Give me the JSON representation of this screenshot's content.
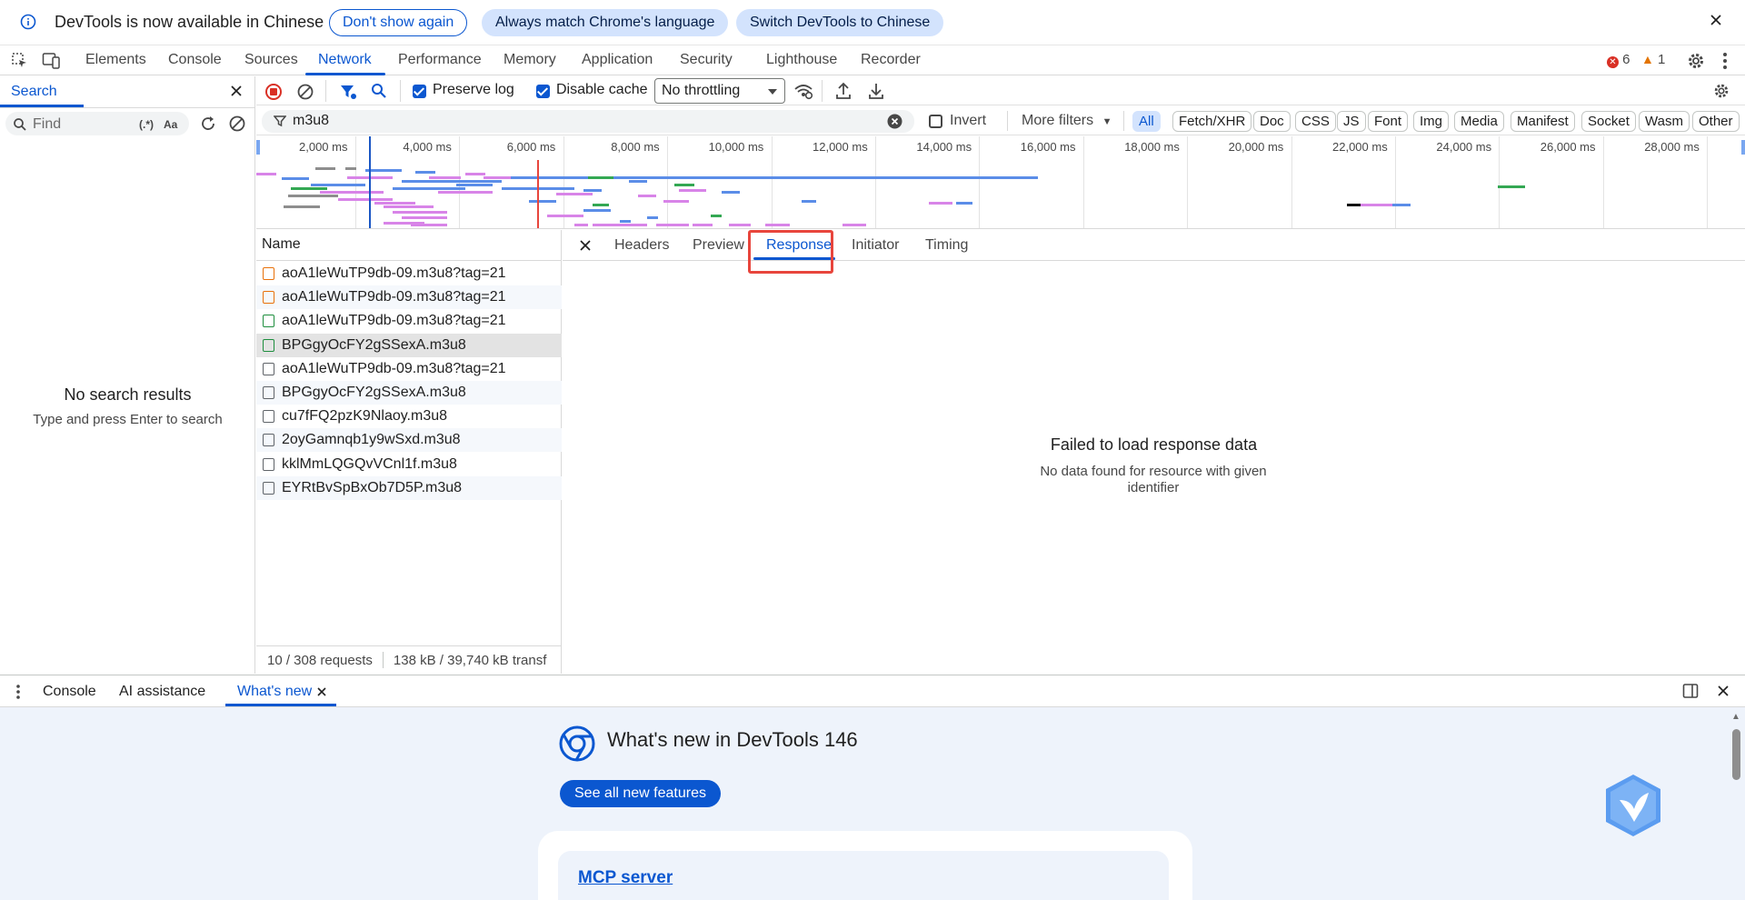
{
  "infobar": {
    "message": "DevTools is now available in Chinese",
    "dont_show": "Don't show again",
    "always_match": "Always match Chrome's language",
    "switch": "Switch DevTools to Chinese"
  },
  "main_tabs": [
    "Elements",
    "Console",
    "Sources",
    "Network",
    "Performance",
    "Memory",
    "Application",
    "Security",
    "Lighthouse",
    "Recorder"
  ],
  "badges": {
    "errors": "6",
    "warnings": "1"
  },
  "search_panel": {
    "tab": "Search",
    "find_placeholder": "Find",
    "regex": "(.*)",
    "case": "Aa",
    "no_results": "No search results",
    "hint": "Type and press Enter to search"
  },
  "toolbar": {
    "preserve_log": "Preserve log",
    "disable_cache": "Disable cache",
    "throttling": "No throttling"
  },
  "filter": {
    "value": "m3u8",
    "invert": "Invert",
    "more_filters": "More filters",
    "chips": [
      "All",
      "Fetch/XHR",
      "Doc",
      "CSS",
      "JS",
      "Font",
      "Img",
      "Media",
      "Manifest",
      "Socket",
      "Wasm",
      "Other"
    ]
  },
  "overview": {
    "labels": [
      "2,000 ms",
      "4,000 ms",
      "6,000 ms",
      "8,000 ms",
      "10,000 ms",
      "12,000 ms",
      "14,000 ms",
      "16,000 ms",
      "18,000 ms",
      "20,000 ms",
      "22,000 ms",
      "24,000 ms",
      "26,000 ms",
      "28,000 ms"
    ]
  },
  "request_list": {
    "header": "Name",
    "rows": [
      {
        "name": "aoA1leWuTP9db-09.m3u8?tag=21",
        "kind": "doc"
      },
      {
        "name": "aoA1leWuTP9db-09.m3u8?tag=21",
        "kind": "doc"
      },
      {
        "name": "aoA1leWuTP9db-09.m3u8?tag=21",
        "kind": "media"
      },
      {
        "name": "BPGgyOcFY2gSSexA.m3u8",
        "kind": "media"
      },
      {
        "name": "aoA1leWuTP9db-09.m3u8?tag=21",
        "kind": "file"
      },
      {
        "name": "BPGgyOcFY2gSSexA.m3u8",
        "kind": "file"
      },
      {
        "name": "cu7fFQ2pzK9Nlaoy.m3u8",
        "kind": "file"
      },
      {
        "name": "2oyGamnqb1y9wSxd.m3u8",
        "kind": "file"
      },
      {
        "name": "kklMmLQGQvVCnl1f.m3u8",
        "kind": "file"
      },
      {
        "name": "EYRtBvSpBxOb7D5P.m3u8",
        "kind": "file"
      }
    ],
    "status_requests": "10 / 308 requests",
    "status_transfer": "138 kB / 39,740 kB transf"
  },
  "detail_tabs": [
    "Headers",
    "Preview",
    "Response",
    "Initiator",
    "Timing"
  ],
  "detail": {
    "fail_title": "Failed to load response data",
    "fail_sub": "No data found for resource with given identifier"
  },
  "drawer": {
    "tabs": [
      "Console",
      "AI assistance",
      "What's new"
    ],
    "whats_new_title": "What's new in DevTools 146",
    "see_all": "See all new features",
    "card_link": "MCP server"
  },
  "colors": {
    "accent": "#0b57d0",
    "error": "#d93025",
    "warning": "#e37400",
    "highlight": "#e8453c"
  }
}
